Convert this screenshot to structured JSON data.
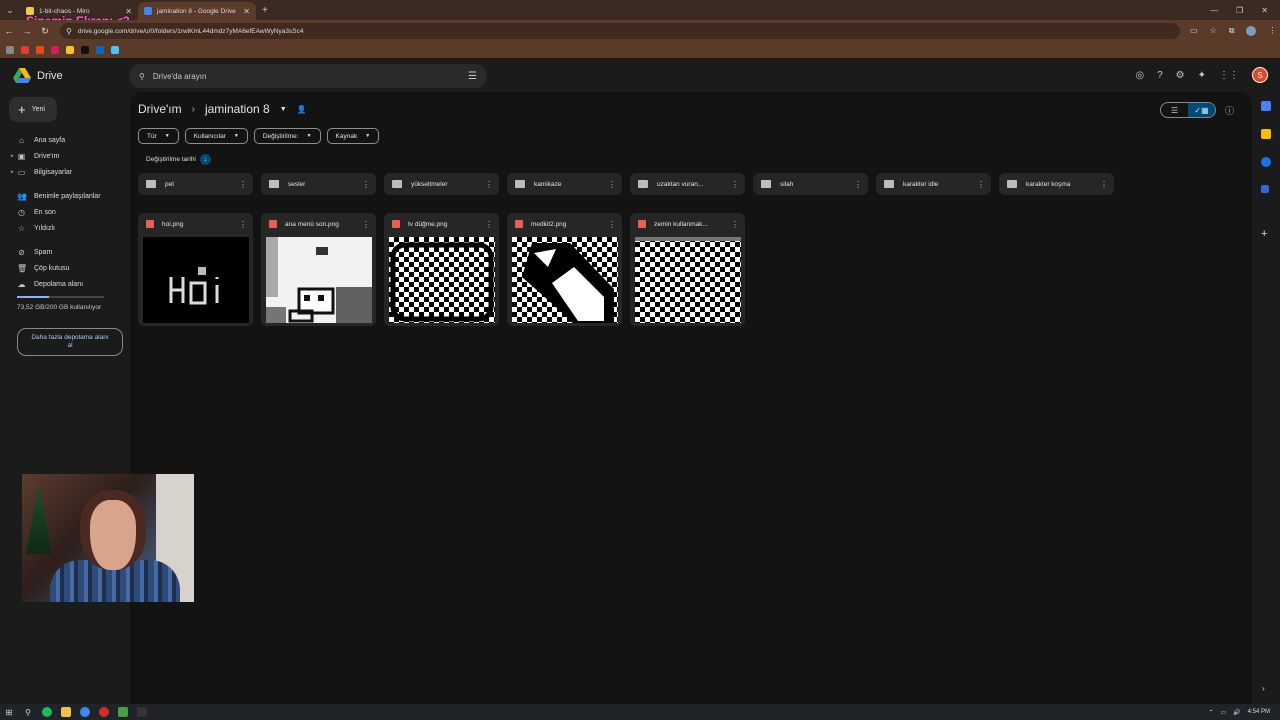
{
  "browser": {
    "tabs": [
      {
        "label": "1-bit-chaos - Miro",
        "color": "#f2c94c",
        "active": false
      },
      {
        "label": "jamination 8 - Google Drive",
        "color": "#4285f4",
        "active": true
      }
    ],
    "url": "drive.google.com/drive/u/0/folders/1rwlKmL44dmdz7yMA6efEAwWyNya3sSc4",
    "overlay_text": "Sinemin Ekranı <3"
  },
  "drive": {
    "app_name": "Drive",
    "search_placeholder": "Drive'da arayın",
    "user_initial": "S"
  },
  "sidebar": {
    "new_label": "Yeni",
    "items": [
      {
        "label": "Ana sayfa",
        "icon": "home-icon"
      },
      {
        "label": "Drive'ım",
        "icon": "my-drive-icon"
      },
      {
        "label": "Bilgisayarlar",
        "icon": "computers-icon"
      },
      {
        "label": "Benimle paylaşılanlar",
        "icon": "shared-icon"
      },
      {
        "label": "En son",
        "icon": "clock-icon"
      },
      {
        "label": "Yıldızlı",
        "icon": "star-icon"
      },
      {
        "label": "Spam",
        "icon": "spam-icon"
      },
      {
        "label": "Çöp kutusu",
        "icon": "trash-icon"
      },
      {
        "label": "Depolama alanı",
        "icon": "cloud-icon"
      }
    ],
    "storage_text": "73,52 GB/200 GB kullanılıyor",
    "storage_fraction": 0.3676,
    "storage_button": "Daha fazla depolama alanı al"
  },
  "main": {
    "breadcrumb_root": "Drive'ım",
    "breadcrumb_current": "jamination 8",
    "filters": [
      "Tür",
      "Kullanıcılar",
      "Değiştirilme:",
      "Kaynak"
    ],
    "sort_label": "Değiştirilme tarihi",
    "folders": [
      "pet",
      "sesler",
      "yükseltmeler",
      "kamikaze",
      "uzaktan vuran...",
      "silah",
      "karakter idle",
      "karakter koşma"
    ],
    "files": [
      {
        "name": "hoi.png",
        "thumb": "hoi"
      },
      {
        "name": "ana menü son.png",
        "thumb": "menu"
      },
      {
        "name": "tv düğme.png",
        "thumb": "tv"
      },
      {
        "name": "medkit2.png",
        "thumb": "medkit"
      },
      {
        "name": "zemin kullanmak...",
        "thumb": "checker"
      }
    ]
  },
  "taskbar": {
    "time": "4:54 PM"
  }
}
